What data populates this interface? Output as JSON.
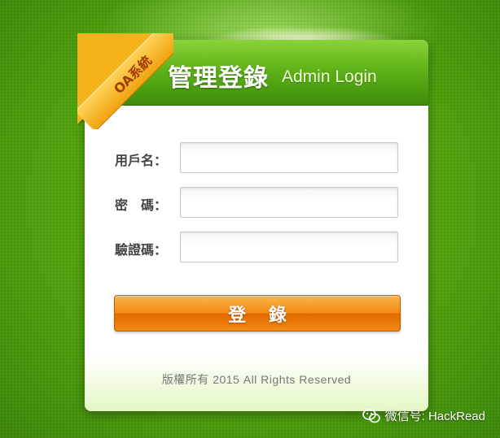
{
  "header": {
    "title_cn": "管理登錄",
    "title_en": "Admin Login",
    "ribbon": "OA系統"
  },
  "form": {
    "username_label": "用戶名：",
    "password_label": "密　碼：",
    "captcha_label": "驗證碼：",
    "username_value": "",
    "password_value": "",
    "captcha_value": ""
  },
  "login_button": "登 錄",
  "footer": {
    "copyright": "版權所有  2015 All Rights Reserved"
  },
  "watermark": {
    "text": "微信号: HackRead",
    "icon": "wechat-icon"
  },
  "colors": {
    "background": "#4fa00f",
    "header": "#5fb318",
    "button": "#f28a12",
    "ribbon": "#f5b21a"
  }
}
